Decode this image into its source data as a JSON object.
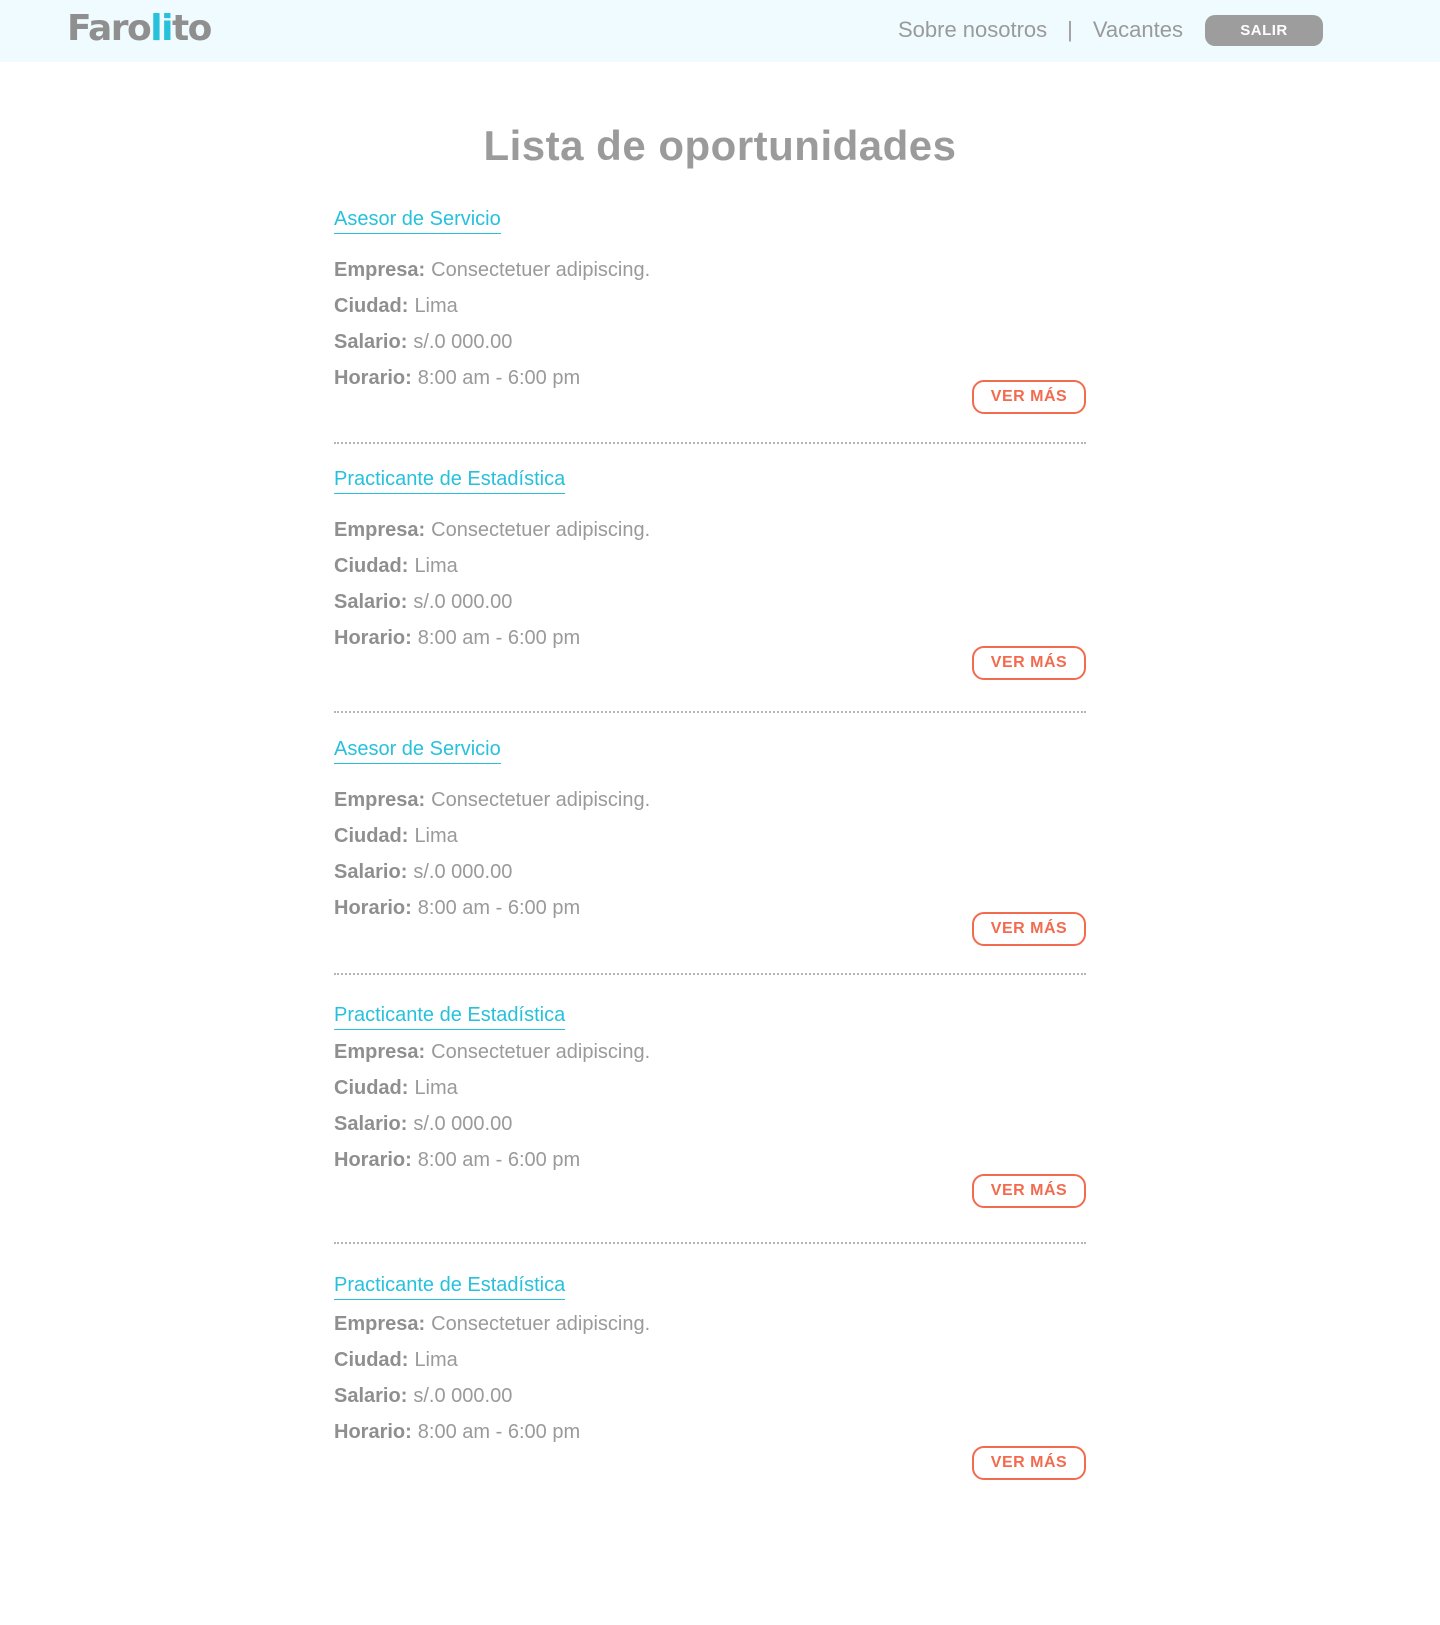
{
  "header": {
    "logo": {
      "part1": "Faro",
      "part2": "li",
      "part3": "to"
    },
    "nav": {
      "about": "Sobre nosotros",
      "separator": "|",
      "vacancies": "Vacantes",
      "logout": "SALIR"
    }
  },
  "page_title": "Lista de oportunidades",
  "labels": {
    "company": "Empresa:",
    "city": "Ciudad:",
    "salary": "Salario:",
    "schedule": "Horario:",
    "more": "VER MÁS"
  },
  "jobs": [
    {
      "title": "Asesor de Servicio",
      "company": "Consectetuer adipiscing.",
      "city": "Lima",
      "salary": "s/.0 000.00",
      "schedule": "8:00 am - 6:00 pm"
    },
    {
      "title": "Practicante de Estadística",
      "company": "Consectetuer adipiscing.",
      "city": "Lima",
      "salary": "s/.0 000.00",
      "schedule": "8:00 am - 6:00 pm"
    },
    {
      "title": "Asesor de Servicio",
      "company": "Consectetuer adipiscing.",
      "city": "Lima",
      "salary": "s/.0 000.00",
      "schedule": "8:00 am - 6:00 pm"
    },
    {
      "title": "Practicante de Estadística",
      "company": "Consectetuer adipiscing.",
      "city": "Lima",
      "salary": "s/.0 000.00",
      "schedule": "8:00 am - 6:00 pm"
    },
    {
      "title": "Practicante de Estadística",
      "company": "Consectetuer adipiscing.",
      "city": "Lima",
      "salary": "s/.0 000.00",
      "schedule": "8:00 am - 6:00 pm"
    }
  ],
  "colors": {
    "accent": "#27c1dc",
    "button": "#f26b4f",
    "header_bg": "#effbff",
    "text": "#9a9a9a"
  }
}
